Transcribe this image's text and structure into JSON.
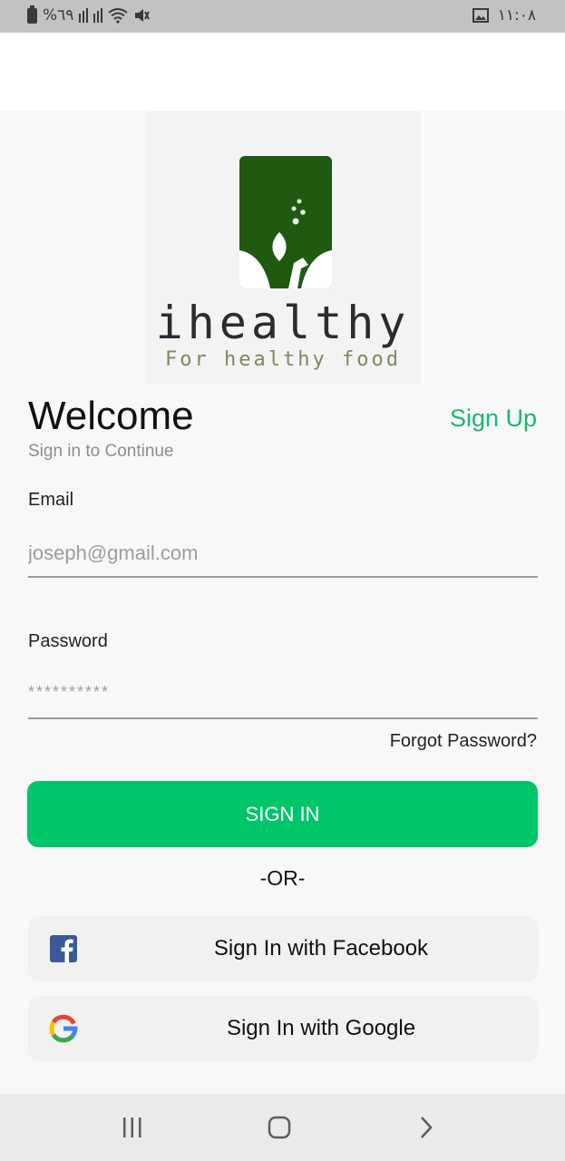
{
  "status_bar": {
    "battery_percent": "%٦٩",
    "time": "١١:٠٨"
  },
  "logo": {
    "brand": "ihealthy",
    "tagline": "For healthy food"
  },
  "header": {
    "title": "Welcome",
    "subtitle": "Sign in to Continue",
    "signup_link": "Sign Up"
  },
  "form": {
    "email_label": "Email",
    "email_placeholder": "joseph@gmail.com",
    "password_label": "Password",
    "password_placeholder": "**********",
    "forgot_link": "Forgot Password?",
    "signin_button": "SIGN IN",
    "divider": "-OR-"
  },
  "social": {
    "facebook_label": "Sign In with Facebook",
    "google_label": "Sign In with Google"
  },
  "colors": {
    "accent": "#00c66a",
    "link": "#17b86e",
    "logo_green": "#1e5b10"
  },
  "icons": {
    "status": [
      "battery-icon",
      "signal-icon",
      "wifi-icon",
      "mute-icon",
      "image-icon"
    ],
    "nav": [
      "recent-apps-icon",
      "home-icon",
      "back-icon"
    ]
  }
}
